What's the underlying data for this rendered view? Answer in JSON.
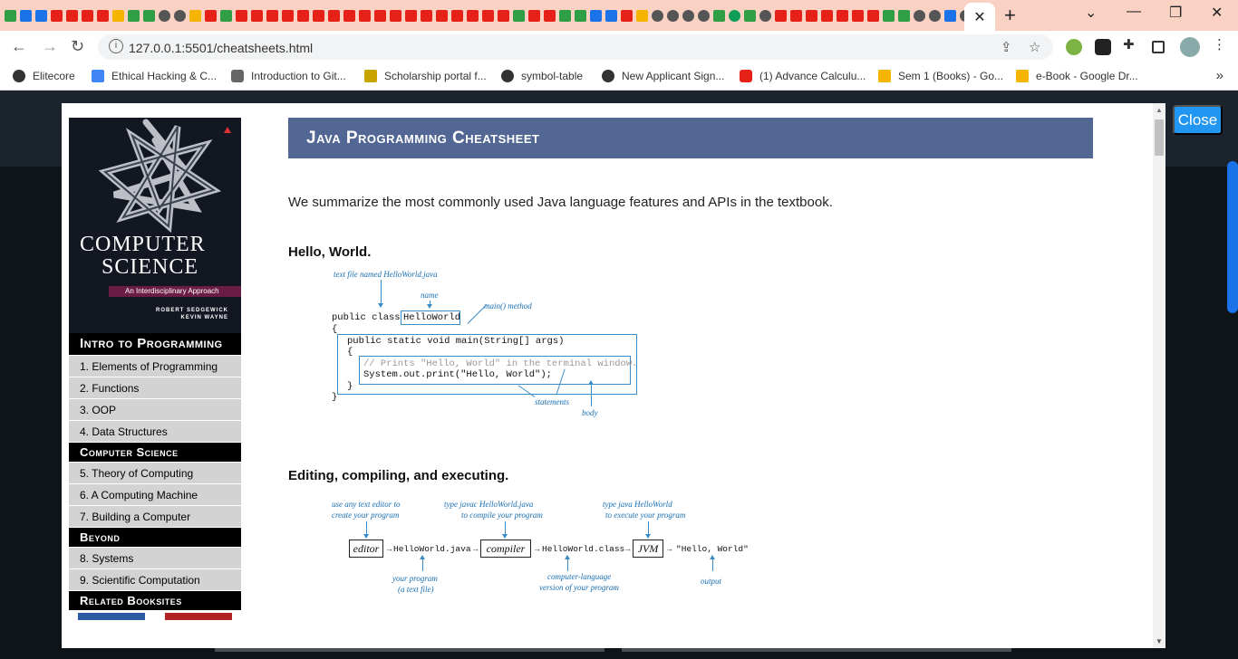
{
  "browser": {
    "tab_close_glyph": "✕",
    "new_tab_glyph": "+",
    "window": {
      "dropdown": "⌄",
      "minimize": "—",
      "restore": "❐",
      "close": "✕"
    },
    "nav": {
      "back": "←",
      "forward": "→",
      "reload": "↻"
    },
    "url": "127.0.0.1:5501/cheatsheets.html",
    "omnibox_share": "⇪",
    "omnibox_star": "☆",
    "bookmarks": [
      {
        "label": "Elitecore",
        "icon": "globe-icon"
      },
      {
        "label": "Ethical Hacking & C...",
        "icon": "docs-icon"
      },
      {
        "label": "Introduction to Git...",
        "icon": "github-icon"
      },
      {
        "label": "Scholarship portal f...",
        "icon": "cap-icon"
      },
      {
        "label": "symbol-table",
        "icon": "globe-icon"
      },
      {
        "label": "New Applicant Sign...",
        "icon": "globe-icon"
      },
      {
        "label": "(1) Advance Calculu...",
        "icon": "youtube-icon"
      },
      {
        "label": "Sem 1 (Books) - Go...",
        "icon": "drive-icon"
      },
      {
        "label": "e-Book - Google Dr...",
        "icon": "drive-icon"
      }
    ],
    "bookmarks_more": "»"
  },
  "modal": {
    "close_label": "Close",
    "scroll_up": "▲",
    "scroll_down": "▼"
  },
  "cover": {
    "title_line1": "COMPUTER",
    "title_line2": "SCIENCE",
    "subtitle": "An Interdisciplinary Approach",
    "author1": "ROBERT SEDGEWICK",
    "author2": "KEVIN WAYNE"
  },
  "sidebar": {
    "sections": [
      {
        "heading": "Intro to Programming",
        "items": [
          "1.  Elements of Programming",
          "2.  Functions",
          "3.  OOP",
          "4.  Data Structures"
        ]
      },
      {
        "heading": "Computer Science",
        "items": [
          "5.  Theory of Computing",
          "6.  A Computing Machine",
          "7.  Building a Computer"
        ]
      },
      {
        "heading": "Beyond",
        "items": [
          "8.  Systems",
          "9.  Scientific Computation"
        ]
      },
      {
        "heading": "Related Booksites",
        "items": []
      }
    ]
  },
  "main": {
    "title": "Java Programming Cheatsheet",
    "intro": "We summarize the most commonly used Java language features and APIs in the textbook.",
    "section1_heading": "Hello, World.",
    "section2_heading": "Editing, compiling, and executing."
  },
  "fig1": {
    "note_file": "text file named  HelloWorld.java",
    "note_name": "name",
    "note_main": "main() method",
    "line_class": "public class",
    "class_name": "HelloWorld",
    "brace_open": "{",
    "line_main": "public static void main(String[] args)",
    "inner_brace_open": "{",
    "comment": "// Prints \"Hello, World\" in the terminal window.",
    "println": "System.out.print(\"Hello, World\");",
    "inner_brace_close": "}",
    "brace_close": "}",
    "note_statements": "statements",
    "note_body": "body"
  },
  "fig2": {
    "note_editor_1": "use any text editor to",
    "note_editor_2": "create your program",
    "note_javac_1": "type  javac HelloWorld.java",
    "note_javac_2": "to compile your program",
    "note_java_1": "type  java HelloWorld",
    "note_java_2": "to execute your program",
    "box_editor": "editor",
    "file_java": "HelloWorld.java",
    "box_compiler": "compiler",
    "file_class": "HelloWorld.class",
    "box_jvm": "JVM",
    "output_text": "\"Hello, World\"",
    "note_program_1": "your program",
    "note_program_2": "(a text file)",
    "note_bytecode_1": "computer-language",
    "note_bytecode_2": "version of your program",
    "note_output": "output",
    "arrow": "→"
  }
}
